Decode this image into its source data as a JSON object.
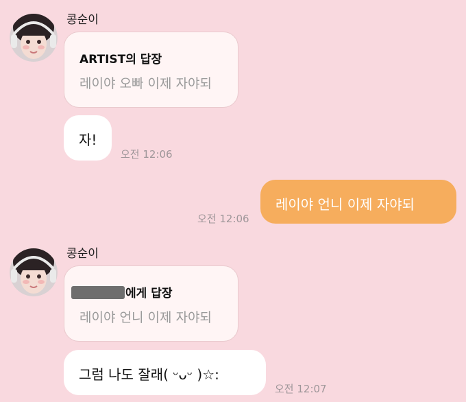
{
  "messages": [
    {
      "sender": "콩순이",
      "reply_heading": "ARTIST의 답장",
      "reply_body": "레이야 오빠 이제 자야되",
      "text": "자!",
      "time": "오전 12:06"
    },
    {
      "outgoing_text": "레이야 언니 이제 자야되",
      "time": "오전 12:06"
    },
    {
      "sender": "콩순이",
      "reply_heading_suffix": "에게 답장",
      "reply_body": "레이야 언니 이제 자야되",
      "text": "그럼 나도 잘래( ᵕᴗᵕ )☆:",
      "time": "오전 12:07"
    }
  ],
  "colors": {
    "background": "#f9d9df",
    "outgoing_bubble": "#f6ad5d",
    "incoming_bubble": "#ffffff",
    "reply_card": "#fff5f5",
    "timestamp": "#9e9699"
  },
  "icons": {
    "avatar": "profile-photo-avatar",
    "redaction": "redacted-name-block"
  }
}
